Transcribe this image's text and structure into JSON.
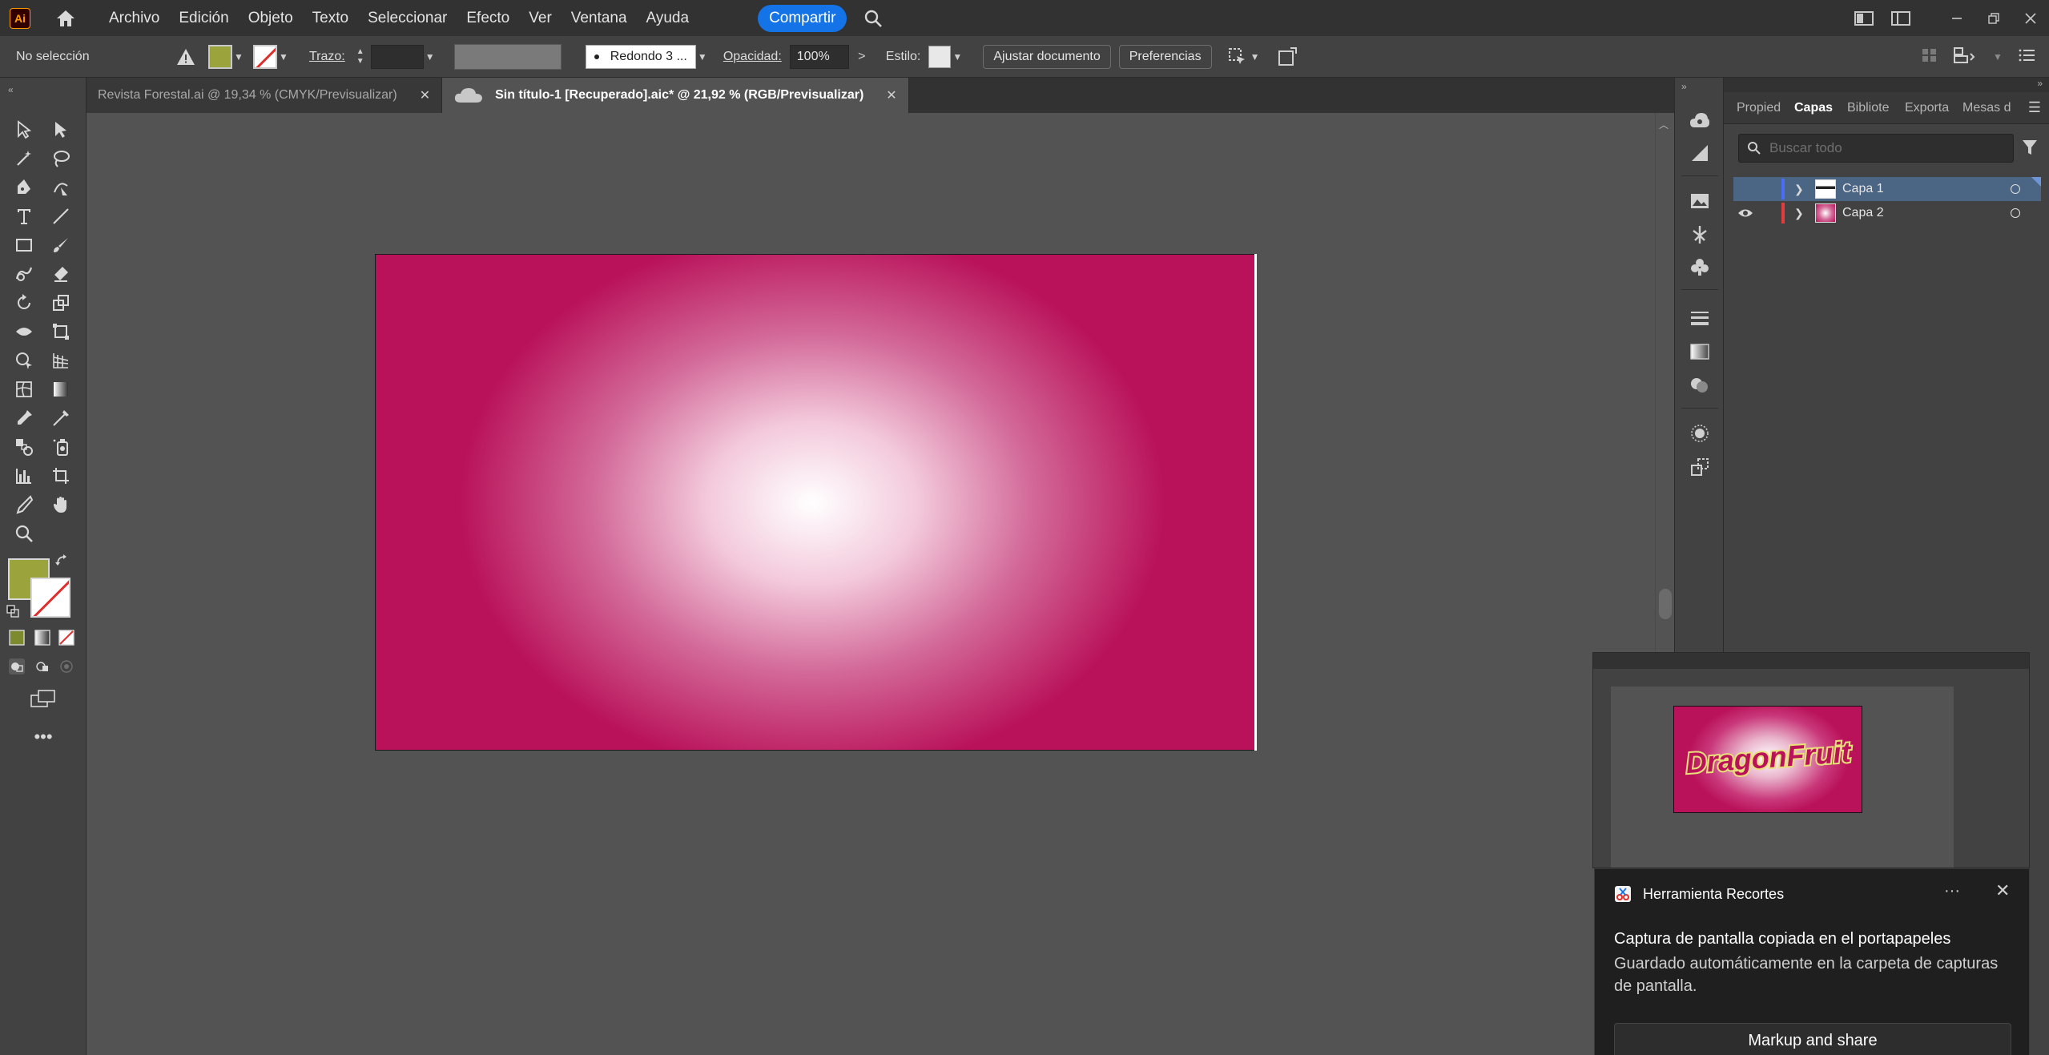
{
  "app": {
    "logo_text": "Ai",
    "accent": "#ff9a00"
  },
  "menu": {
    "items": [
      "Archivo",
      "Edición",
      "Objeto",
      "Texto",
      "Seleccionar",
      "Efecto",
      "Ver",
      "Ventana",
      "Ayuda"
    ],
    "share_label": "Compartir"
  },
  "controlbar": {
    "selection_status": "No selección",
    "stroke_label": "Trazo:",
    "brush_label": "Redondo 3 ...",
    "opacity_label": "Opacidad:",
    "opacity_value": "100%",
    "style_label": "Estilo:",
    "fit_document_label": "Ajustar documento",
    "preferences_label": "Preferencias",
    "fill_color": "#9aa33c",
    "stroke_color": "none"
  },
  "tabs": [
    {
      "label": "Revista Forestal.ai @ 19,34 % (CMYK/Previsualizar)",
      "close": "✕"
    },
    {
      "label": "Sin título-1 [Recuperado].aic* @ 21,92 % (RGB/Previsualizar)",
      "close": "✕"
    }
  ],
  "canvas": {
    "gradient_center": "#ffffff",
    "gradient_edge": "#b9125a"
  },
  "panel": {
    "tabs": [
      "Propied",
      "Capas",
      "Bibliote",
      "Exporta",
      "Mesas d"
    ],
    "search_placeholder": "Buscar todo",
    "layers": [
      {
        "name": "Capa 1",
        "color": "#4a6cf7",
        "selected": true,
        "visible": false
      },
      {
        "name": "Capa 2",
        "color": "#e23c3c",
        "selected": false,
        "visible": true
      }
    ]
  },
  "snip_preview": {
    "artwork_text": "DragonFruit"
  },
  "notification": {
    "app_name": "Herramienta Recortes",
    "more": "···",
    "close": "✕",
    "title": "Captura de pantalla copiada en el portapapeles",
    "body": "Guardado automáticamente en la carpeta de capturas de pantalla.",
    "action_label": "Markup and share"
  }
}
